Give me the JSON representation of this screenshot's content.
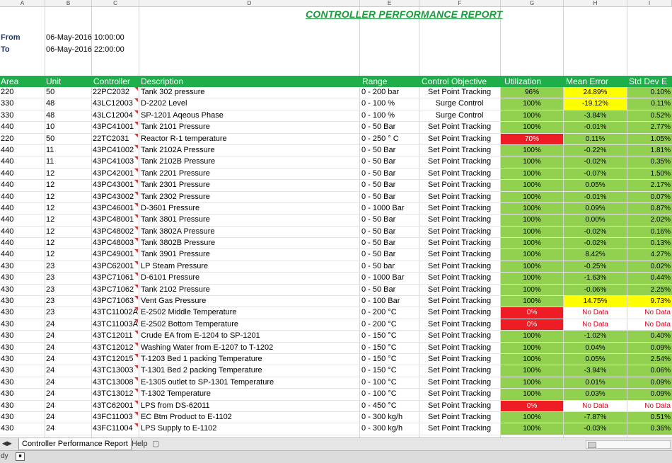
{
  "columns": [
    "A",
    "B",
    "C",
    "D",
    "E",
    "F",
    "G",
    "H",
    "I"
  ],
  "title": "CONTROLLER PERFORMANCE REPORT",
  "from": {
    "label": "From",
    "value": "06-May-2016 10:00:00"
  },
  "to": {
    "label": "To",
    "value": "06-May-2016 22:00:00"
  },
  "headers": [
    "Area",
    "Unit",
    "Controller",
    "Description",
    "Range",
    "Control Objective",
    "Utilization",
    "Mean Error",
    "Std Dev E"
  ],
  "rows": [
    [
      "220",
      "50",
      "22PC2032",
      "Tank 302 pressure",
      "0 - 200 bar",
      "Set Point Tracking",
      "96%",
      "24.89%",
      "0.10%"
    ],
    [
      "330",
      "48",
      "43LC12003",
      "D-2202 Level",
      "0 - 100 %",
      "Surge Control",
      "100%",
      "-19.12%",
      "0.11%"
    ],
    [
      "330",
      "48",
      "43LC12004",
      "SP-1201 Aqeous Phase",
      "0 - 100 %",
      "Surge Control",
      "100%",
      "-3.84%",
      "0.52%"
    ],
    [
      "440",
      "10",
      "43PC41001",
      "Tank 2101 Pressure",
      "0 - 50 Bar",
      "Set Point Tracking",
      "100%",
      "-0.01%",
      "2.77%"
    ],
    [
      "220",
      "50",
      "22TC2031",
      "Reactor R-1 temperature",
      "0 - 250 ° C",
      "Set Point Tracking",
      "70%",
      "0.11%",
      "1.05%"
    ],
    [
      "440",
      "11",
      "43PC41002",
      "Tank 2102A Pressure",
      "0 - 50 Bar",
      "Set Point Tracking",
      "100%",
      "-0.22%",
      "1.81%"
    ],
    [
      "440",
      "11",
      "43PC41003",
      "Tank 2102B Pressure",
      "0 - 50 Bar",
      "Set Point Tracking",
      "100%",
      "-0.02%",
      "0.35%"
    ],
    [
      "440",
      "12",
      "43PC42001",
      "Tank 2201 Pressure",
      "0 - 50 Bar",
      "Set Point Tracking",
      "100%",
      "-0.07%",
      "1.50%"
    ],
    [
      "440",
      "12",
      "43PC43001",
      "Tank 2301 Pressure",
      "0 - 50 Bar",
      "Set Point Tracking",
      "100%",
      "0.05%",
      "2.17%"
    ],
    [
      "440",
      "12",
      "43PC43002",
      "Tank 2302 Pressure",
      "0 - 50 Bar",
      "Set Point Tracking",
      "100%",
      "-0.01%",
      "0.07%"
    ],
    [
      "440",
      "12",
      "43PC46001",
      "D-3601 Pressure",
      "0 - 1000 Bar",
      "Set Point Tracking",
      "100%",
      "0.09%",
      "0.87%"
    ],
    [
      "440",
      "12",
      "43PC48001",
      "Tank 3801 Pressure",
      "0 - 50 Bar",
      "Set Point Tracking",
      "100%",
      "0.00%",
      "2.02%"
    ],
    [
      "440",
      "12",
      "43PC48002",
      "Tank 3802A Pressure",
      "0 - 50 Bar",
      "Set Point Tracking",
      "100%",
      "-0.02%",
      "0.16%"
    ],
    [
      "440",
      "12",
      "43PC48003",
      "Tank 3802B Pressure",
      "0 - 50 Bar",
      "Set Point Tracking",
      "100%",
      "-0.02%",
      "0.13%"
    ],
    [
      "440",
      "12",
      "43PC49001",
      "Tank 3901 Pressure",
      "0 - 50 Bar",
      "Set Point Tracking",
      "100%",
      "8.42%",
      "4.27%"
    ],
    [
      "430",
      "23",
      "43PC62001",
      "LP Steam Pressure",
      "0 - 50 bar",
      "Set Point Tracking",
      "100%",
      "-0.25%",
      "0.02%"
    ],
    [
      "430",
      "23",
      "43PC71061",
      "D-6101 Pressure",
      "0 - 1000 Bar",
      "Set Point Tracking",
      "100%",
      "-1.63%",
      "0.44%"
    ],
    [
      "430",
      "23",
      "43PC71062",
      "Tank 2102 Pressure",
      "0 - 50 Bar",
      "Set Point Tracking",
      "100%",
      "-0.06%",
      "2.25%"
    ],
    [
      "430",
      "23",
      "43PC71063",
      "Vent Gas Pressure",
      "0 - 100 Bar",
      "Set Point Tracking",
      "100%",
      "14.75%",
      "9.73%"
    ],
    [
      "430",
      "23",
      "43TC11002A",
      "E-2502 Middle Temperature",
      "0 - 200 °C",
      "Set Point Tracking",
      "0%",
      "No Data",
      "No Data"
    ],
    [
      "430",
      "24",
      "43TC11003A",
      "E-2502 Bottom Temperature",
      "0 - 200 °C",
      "Set Point Tracking",
      "0%",
      "No Data",
      "No Data"
    ],
    [
      "430",
      "24",
      "43TC12011",
      "Crude EA from E-1204 to SP-1201",
      "0 - 150 °C",
      "Set Point Tracking",
      "100%",
      "-1.02%",
      "0.40%"
    ],
    [
      "430",
      "24",
      "43TC12012",
      "Washing Water from E-1207 to T-1202",
      "0 - 150 °C",
      "Set Point Tracking",
      "100%",
      "0.04%",
      "0.09%"
    ],
    [
      "430",
      "24",
      "43TC12015",
      "T-1203 Bed 1 packing Temperature",
      "0 - 150 °C",
      "Set Point Tracking",
      "100%",
      "0.05%",
      "2.54%"
    ],
    [
      "430",
      "24",
      "43TC13003",
      "T-1301 Bed 2 packing Temperature",
      "0 - 150 °C",
      "Set Point Tracking",
      "100%",
      "-3.94%",
      "0.06%"
    ],
    [
      "430",
      "24",
      "43TC13008",
      "E-1305 outlet to SP-1301 Temperature",
      "0 - 100 °C",
      "Set Point Tracking",
      "100%",
      "0.01%",
      "0.09%"
    ],
    [
      "430",
      "24",
      "43TC13012",
      "T-1302 Temperature",
      "0 - 100 °C",
      "Set Point Tracking",
      "100%",
      "0.03%",
      "0.09%"
    ],
    [
      "430",
      "24",
      "43TC62001",
      "LPS from DS-62011",
      "0 - 450 °C",
      "Set Point Tracking",
      "0%",
      "No Data",
      "No Data"
    ],
    [
      "430",
      "24",
      "43FC11003",
      "EC Btm Product to E-1102",
      "0 - 300 kg/h",
      "Set Point Tracking",
      "100%",
      "-7.87%",
      "0.51%"
    ],
    [
      "430",
      "24",
      "43FC11004",
      "LPS Supply to E-1102",
      "0 - 300 kg/h",
      "Set Point Tracking",
      "100%",
      "-0.03%",
      "0.36%"
    ]
  ],
  "row_status": [
    [
      "ok",
      "warn",
      "ok"
    ],
    [
      "ok",
      "warn",
      "ok"
    ],
    [
      "ok",
      "ok",
      "ok"
    ],
    [
      "ok",
      "ok",
      "ok"
    ],
    [
      "bad",
      "ok",
      "ok"
    ],
    [
      "ok",
      "ok",
      "ok"
    ],
    [
      "ok",
      "ok",
      "ok"
    ],
    [
      "ok",
      "ok",
      "ok"
    ],
    [
      "ok",
      "ok",
      "ok"
    ],
    [
      "ok",
      "ok",
      "ok"
    ],
    [
      "ok",
      "ok",
      "ok"
    ],
    [
      "ok",
      "ok",
      "ok"
    ],
    [
      "ok",
      "ok",
      "ok"
    ],
    [
      "ok",
      "ok",
      "ok"
    ],
    [
      "ok",
      "ok",
      "ok"
    ],
    [
      "ok",
      "ok",
      "ok"
    ],
    [
      "ok",
      "ok",
      "ok"
    ],
    [
      "ok",
      "ok",
      "ok"
    ],
    [
      "ok",
      "warn",
      "warn"
    ],
    [
      "bad",
      "nodata",
      "nodata"
    ],
    [
      "bad",
      "nodata",
      "nodata"
    ],
    [
      "ok",
      "ok",
      "ok"
    ],
    [
      "ok",
      "ok",
      "ok"
    ],
    [
      "ok",
      "ok",
      "ok"
    ],
    [
      "ok",
      "ok",
      "ok"
    ],
    [
      "ok",
      "ok",
      "ok"
    ],
    [
      "ok",
      "ok",
      "ok"
    ],
    [
      "bad",
      "nodata",
      "nodata"
    ],
    [
      "ok",
      "ok",
      "ok"
    ],
    [
      "ok",
      "ok",
      "ok"
    ]
  ],
  "colors": {
    "header_green": "#1eaf4b",
    "ok_green": "#92d050",
    "bad_red": "#ee1c24",
    "warn_yellow": "#ffff00",
    "title_green": "#1b9b3c"
  },
  "sheets": {
    "active": "Controller Performance Report",
    "other": "Help"
  },
  "status": {
    "mode": "dy"
  }
}
